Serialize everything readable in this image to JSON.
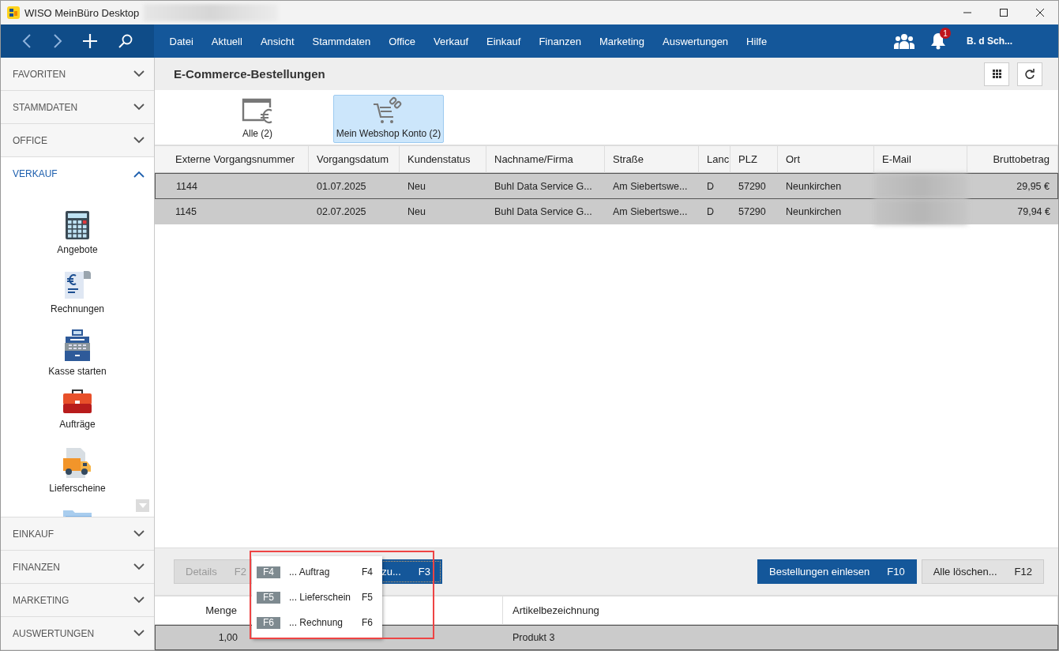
{
  "window": {
    "title": "WISO MeinBüro Desktop"
  },
  "nav": {
    "menu": [
      "Datei",
      "Aktuell",
      "Ansicht",
      "Stammdaten",
      "Office",
      "Verkauf",
      "Einkauf",
      "Finanzen",
      "Marketing",
      "Auswertungen",
      "Hilfe"
    ],
    "notifications": "1",
    "user": "B. d Sch..."
  },
  "sidebar": {
    "sections": [
      {
        "label": "FAVORITEN",
        "expanded": false
      },
      {
        "label": "STAMMDATEN",
        "expanded": false
      },
      {
        "label": "OFFICE",
        "expanded": false
      },
      {
        "label": "VERKAUF",
        "expanded": true,
        "items": [
          {
            "label": "Angebote",
            "kind": "calculator"
          },
          {
            "label": "Rechnungen",
            "kind": "invoice"
          },
          {
            "label": "Kasse starten",
            "kind": "register"
          },
          {
            "label": "Aufträge",
            "kind": "briefcase"
          },
          {
            "label": "Lieferscheine",
            "kind": "truck"
          },
          {
            "kind": "folder"
          }
        ]
      },
      {
        "label": "EINKAUF",
        "expanded": false
      },
      {
        "label": "FINANZEN",
        "expanded": false
      },
      {
        "label": "MARKETING",
        "expanded": false
      },
      {
        "label": "AUSWERTUNGEN",
        "expanded": false
      }
    ]
  },
  "page": {
    "title": "E-Commerce-Bestellungen"
  },
  "filters": [
    {
      "label": "Alle (2)",
      "kind": "all",
      "selected": false
    },
    {
      "label": "Mein Webshop Konto (2)",
      "kind": "webshop",
      "selected": true
    }
  ],
  "orders": {
    "columns": [
      {
        "label": "Externe Vorgangsnummer",
        "kind": "text"
      },
      {
        "label": "Vorgangsdatum",
        "kind": "text"
      },
      {
        "label": "Kundenstatus",
        "kind": "text"
      },
      {
        "label": "Nachname/Firma",
        "kind": "text"
      },
      {
        "label": "Straße",
        "kind": "text"
      },
      {
        "label": "Lanc",
        "kind": "text"
      },
      {
        "label": "PLZ",
        "kind": "text"
      },
      {
        "label": "Ort",
        "kind": "text"
      },
      {
        "label": "E-Mail",
        "kind": "text"
      },
      {
        "label": "Bruttobetrag",
        "kind": "amount"
      }
    ],
    "rows": [
      {
        "cells": [
          "1144",
          "01.07.2025",
          "Neu",
          "Buhl Data Service G...",
          "Am Siebertswe...",
          "D",
          "57290",
          "Neunkirchen",
          null,
          "29,95 €"
        ],
        "selected": true,
        "focused": true
      },
      {
        "cells": [
          "1145",
          "02.07.2025",
          "Neu",
          "Buhl Data Service G...",
          "Am Siebertswe...",
          "D",
          "57290",
          "Neunkirchen",
          null,
          "79,94 €"
        ],
        "selected": true,
        "focused": false
      }
    ]
  },
  "actions_left": [
    {
      "label": "Details",
      "key": "F2",
      "kind": "plain",
      "disabled": true
    },
    {
      "label": "zu...",
      "key": "F3",
      "kind": "primary",
      "disabled": false
    }
  ],
  "actions_right": [
    {
      "label": "Bestellungen einlesen",
      "key": "F10",
      "kind": "primary",
      "disabled": false
    },
    {
      "label": "Alle löschen...",
      "key": "F12",
      "kind": "plain",
      "disabled": false
    }
  ],
  "popup_menu": {
    "items": [
      {
        "badge": "F4",
        "label": "... Auftrag",
        "shortcut": "F4"
      },
      {
        "badge": "F5",
        "label": "... Lieferschein",
        "shortcut": "F5"
      },
      {
        "badge": "F6",
        "label": "... Rechnung",
        "shortcut": "F6"
      }
    ]
  },
  "items_table": {
    "columns": [
      {
        "label": "Menge",
        "kind": "amount"
      },
      {
        "kind": "text"
      },
      {
        "label": "Artikelbezeichnung",
        "kind": "text"
      }
    ],
    "rows": [
      {
        "cells": [
          "1,00",
          null,
          "Produkt 3"
        ],
        "selected": true
      }
    ]
  }
}
